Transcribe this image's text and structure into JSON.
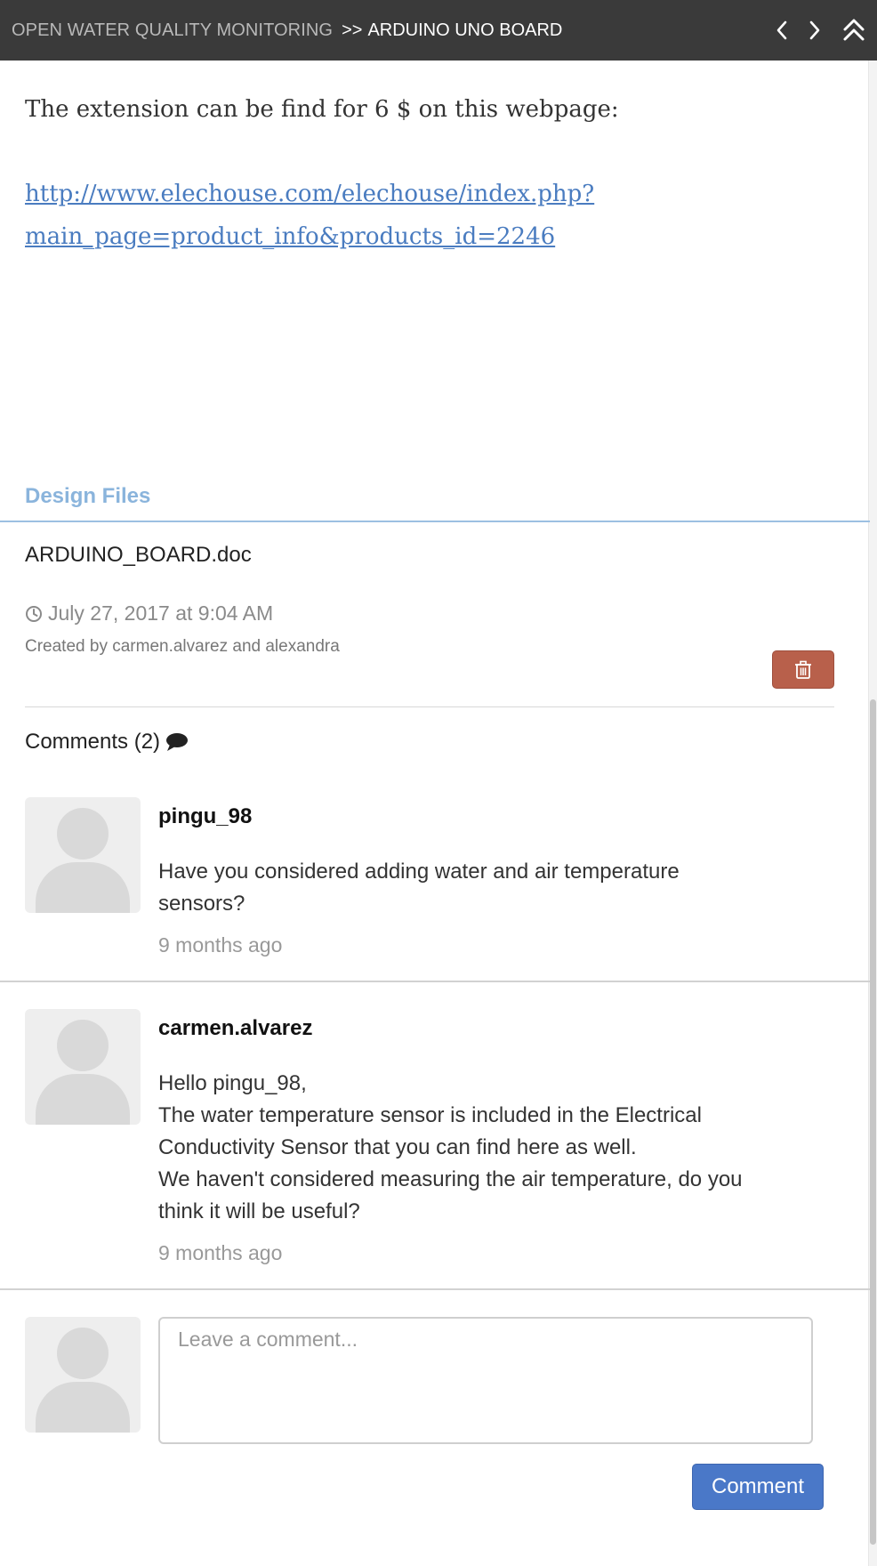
{
  "header": {
    "project": "OPEN WATER QUALITY MONITORING",
    "separator": ">>",
    "current": "ARDUINO UNO BOARD",
    "icons": [
      "chevron-left-icon",
      "chevron-right-icon",
      "double-chevron-up-icon"
    ]
  },
  "content": {
    "intro": "The extension can be find for 6 $ on this webpage:",
    "link_line1": "http://www.elechouse.com/elechouse/index.php?",
    "link_line2": "main_page=product_info&products_id=2246 "
  },
  "design_files": {
    "title": "Design Files",
    "file_name": "ARDUINO_BOARD.doc",
    "date": "July 27, 2017 at 9:04 AM",
    "created_by": "Created by carmen.alvarez and alexandra",
    "delete_icon": "trash-icon"
  },
  "comments": {
    "heading": "Comments (2)",
    "items": [
      {
        "user": "pingu_98",
        "lines": [
          "Have you considered adding water and air temperature",
          "sensors?"
        ],
        "time": "9 months ago"
      },
      {
        "user": "carmen.alvarez",
        "lines": [
          "Hello pingu_98,",
          "The water temperature sensor is included in the Electrical",
          "Conductivity Sensor that you can find here as well.",
          "We haven't considered measuring the air temperature, do you",
          "think it will be useful?"
        ],
        "time": "9 months ago"
      }
    ],
    "new_comment_placeholder": "Leave a comment...",
    "submit_label": "Comment"
  },
  "colors": {
    "topbar": "#3a3a3a",
    "link": "#4a7cc0",
    "section_title": "#8ab4dc",
    "delete_button": "#b8604b",
    "comment_button": "#4a78c8"
  }
}
